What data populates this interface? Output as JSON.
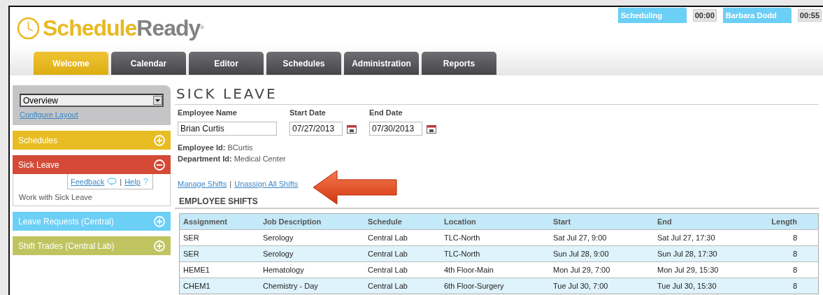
{
  "logo": {
    "part_1": "Schedule",
    "part_2": "Ready",
    "mark": "®"
  },
  "session": [
    {
      "kind": "label",
      "text": "Scheduling"
    },
    {
      "kind": "timer",
      "text": "00:00"
    },
    {
      "kind": "label",
      "text": "Barbara Dodd"
    },
    {
      "kind": "timer",
      "text": "00:55"
    }
  ],
  "tabs": [
    {
      "label": "Welcome",
      "selected": true
    },
    {
      "label": "Calendar",
      "selected": false
    },
    {
      "label": "Editor",
      "selected": false
    },
    {
      "label": "Schedules",
      "selected": false
    },
    {
      "label": "Administration",
      "selected": false
    },
    {
      "label": "Reports",
      "selected": false
    }
  ],
  "sidebar": {
    "view_select": {
      "value": "Overview"
    },
    "configure_link": "Configure Layout",
    "panels": [
      {
        "title": "Schedules",
        "color": "#e8bd24",
        "expanded": false
      },
      {
        "title": "Sick Leave",
        "color": "#d44a37",
        "expanded": true,
        "feedback_link": "Feedback",
        "separator": "|",
        "help_link": "Help",
        "help_icon": "?",
        "body": "Work with Sick Leave"
      },
      {
        "title": "Leave Requests (Central)",
        "color": "#6ccff6",
        "expanded": false
      },
      {
        "title": "Shift Trades (Central Lab)",
        "color": "#c0c460",
        "expanded": false
      }
    ]
  },
  "page": {
    "title": "SICK LEAVE",
    "fields": [
      {
        "label": "Employee Name",
        "value": "Brian Curtis",
        "kind": "text"
      },
      {
        "label": "Start Date",
        "value": "07/27/2013",
        "kind": "date"
      },
      {
        "label": "End Date",
        "value": "07/30/2013",
        "kind": "date"
      }
    ],
    "info": [
      "**Employee Id:** BCurtis",
      "**Department Id:** Medical Center"
    ],
    "links": [
      "Manage Shifts",
      "Unassign All Shifts"
    ],
    "link_separator": "|",
    "section_title": "EMPLOYEE SHIFTS",
    "table": {
      "columns": [
        "Assignment",
        "Job Description",
        "Schedule",
        "Location",
        "Start",
        "End",
        "Length"
      ],
      "rows": [
        [
          "SER",
          "Serology",
          "Central Lab",
          "TLC-North",
          "Sat Jul 27, 9:00",
          "Sat Jul 27, 17:30",
          "8"
        ],
        [
          "SER",
          "Serology",
          "Central Lab",
          "TLC-North",
          "Sun Jul 28, 9:00",
          "Sun Jul 28, 17:30",
          "8"
        ],
        [
          "HEME1",
          "Hematology",
          "Central Lab",
          "4th Floor-Main",
          "Mon Jul 29, 7:00",
          "Mon Jul 29, 15:30",
          "8"
        ],
        [
          "CHEM1",
          "Chemistry - Day",
          "Central Lab",
          "6th Floor-Surgery",
          "Tue Jul 30, 7:00",
          "Tue Jul 30, 15:30",
          "8"
        ]
      ]
    }
  }
}
